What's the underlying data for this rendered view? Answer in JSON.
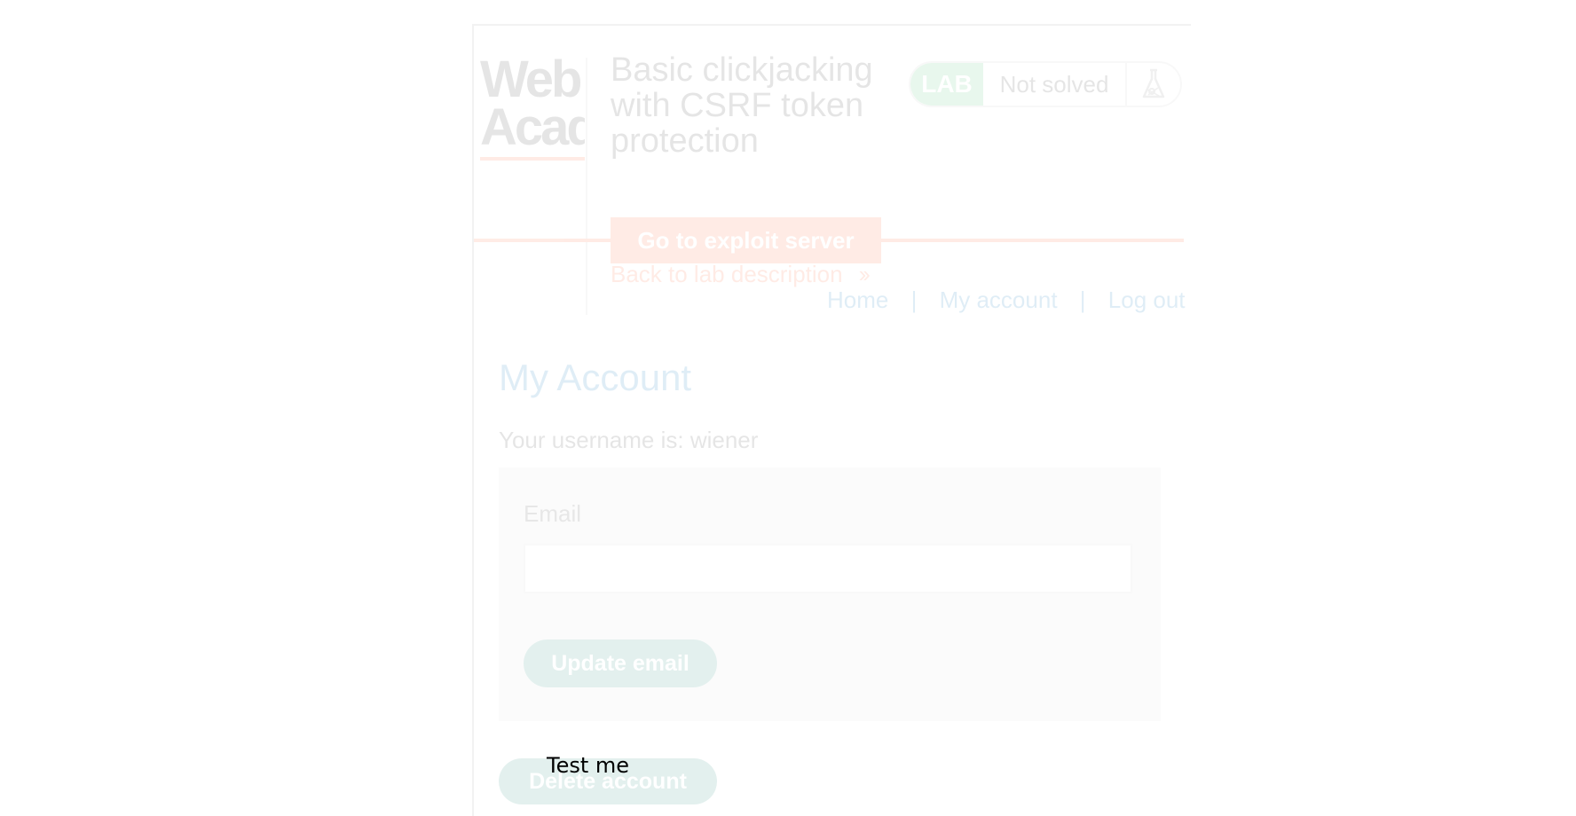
{
  "logo": {
    "line1": "Web",
    "line2": "Academy"
  },
  "lab": {
    "title": "Basic clickjacking with CSRF token protection",
    "badge": "LAB",
    "status": "Not solved",
    "status_icon": "flask-icon",
    "exploit_button": "Go to exploit server",
    "back_link": "Back to lab description",
    "back_icon": "double-chevron-right-icon"
  },
  "nav": {
    "items": [
      {
        "label": "Home"
      },
      {
        "label": "My account"
      },
      {
        "label": "Log out"
      }
    ],
    "separator": "|"
  },
  "account": {
    "heading": "My Account",
    "username_line": "Your username is: wiener",
    "email_label": "Email",
    "email_value": "",
    "update_button": "Update email",
    "delete_button": "Delete account"
  },
  "decoy": {
    "label": "Test me"
  },
  "colors": {
    "accent_orange": "#ff6633",
    "link_blue": "#0071bc",
    "lab_green": "#4cc26f",
    "button_teal": "#1f8c7d",
    "background": "#ffffff"
  }
}
